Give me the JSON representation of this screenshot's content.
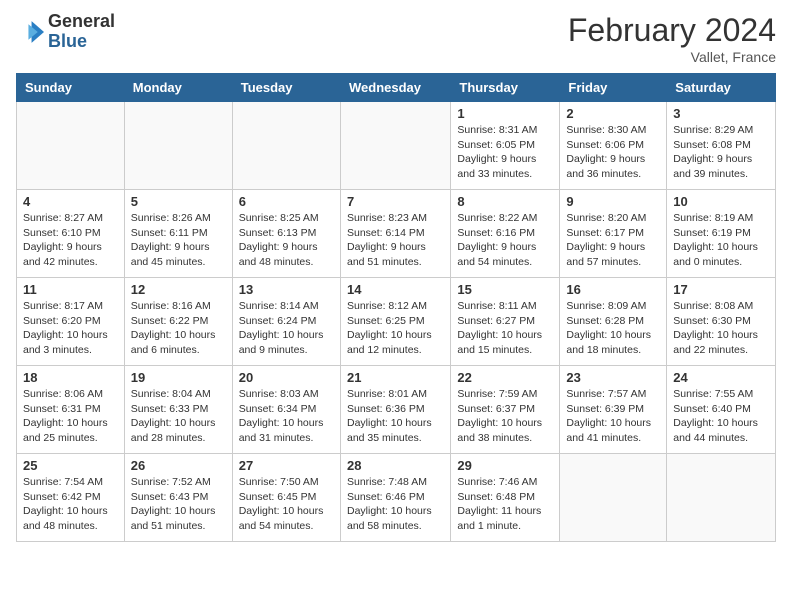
{
  "header": {
    "logo_general": "General",
    "logo_blue": "Blue",
    "title": "February 2024",
    "subtitle": "Vallet, France"
  },
  "days_of_week": [
    "Sunday",
    "Monday",
    "Tuesday",
    "Wednesday",
    "Thursday",
    "Friday",
    "Saturday"
  ],
  "weeks": [
    [
      {
        "day": "",
        "info": ""
      },
      {
        "day": "",
        "info": ""
      },
      {
        "day": "",
        "info": ""
      },
      {
        "day": "",
        "info": ""
      },
      {
        "day": "1",
        "info": "Sunrise: 8:31 AM\nSunset: 6:05 PM\nDaylight: 9 hours and 33 minutes."
      },
      {
        "day": "2",
        "info": "Sunrise: 8:30 AM\nSunset: 6:06 PM\nDaylight: 9 hours and 36 minutes."
      },
      {
        "day": "3",
        "info": "Sunrise: 8:29 AM\nSunset: 6:08 PM\nDaylight: 9 hours and 39 minutes."
      }
    ],
    [
      {
        "day": "4",
        "info": "Sunrise: 8:27 AM\nSunset: 6:10 PM\nDaylight: 9 hours and 42 minutes."
      },
      {
        "day": "5",
        "info": "Sunrise: 8:26 AM\nSunset: 6:11 PM\nDaylight: 9 hours and 45 minutes."
      },
      {
        "day": "6",
        "info": "Sunrise: 8:25 AM\nSunset: 6:13 PM\nDaylight: 9 hours and 48 minutes."
      },
      {
        "day": "7",
        "info": "Sunrise: 8:23 AM\nSunset: 6:14 PM\nDaylight: 9 hours and 51 minutes."
      },
      {
        "day": "8",
        "info": "Sunrise: 8:22 AM\nSunset: 6:16 PM\nDaylight: 9 hours and 54 minutes."
      },
      {
        "day": "9",
        "info": "Sunrise: 8:20 AM\nSunset: 6:17 PM\nDaylight: 9 hours and 57 minutes."
      },
      {
        "day": "10",
        "info": "Sunrise: 8:19 AM\nSunset: 6:19 PM\nDaylight: 10 hours and 0 minutes."
      }
    ],
    [
      {
        "day": "11",
        "info": "Sunrise: 8:17 AM\nSunset: 6:20 PM\nDaylight: 10 hours and 3 minutes."
      },
      {
        "day": "12",
        "info": "Sunrise: 8:16 AM\nSunset: 6:22 PM\nDaylight: 10 hours and 6 minutes."
      },
      {
        "day": "13",
        "info": "Sunrise: 8:14 AM\nSunset: 6:24 PM\nDaylight: 10 hours and 9 minutes."
      },
      {
        "day": "14",
        "info": "Sunrise: 8:12 AM\nSunset: 6:25 PM\nDaylight: 10 hours and 12 minutes."
      },
      {
        "day": "15",
        "info": "Sunrise: 8:11 AM\nSunset: 6:27 PM\nDaylight: 10 hours and 15 minutes."
      },
      {
        "day": "16",
        "info": "Sunrise: 8:09 AM\nSunset: 6:28 PM\nDaylight: 10 hours and 18 minutes."
      },
      {
        "day": "17",
        "info": "Sunrise: 8:08 AM\nSunset: 6:30 PM\nDaylight: 10 hours and 22 minutes."
      }
    ],
    [
      {
        "day": "18",
        "info": "Sunrise: 8:06 AM\nSunset: 6:31 PM\nDaylight: 10 hours and 25 minutes."
      },
      {
        "day": "19",
        "info": "Sunrise: 8:04 AM\nSunset: 6:33 PM\nDaylight: 10 hours and 28 minutes."
      },
      {
        "day": "20",
        "info": "Sunrise: 8:03 AM\nSunset: 6:34 PM\nDaylight: 10 hours and 31 minutes."
      },
      {
        "day": "21",
        "info": "Sunrise: 8:01 AM\nSunset: 6:36 PM\nDaylight: 10 hours and 35 minutes."
      },
      {
        "day": "22",
        "info": "Sunrise: 7:59 AM\nSunset: 6:37 PM\nDaylight: 10 hours and 38 minutes."
      },
      {
        "day": "23",
        "info": "Sunrise: 7:57 AM\nSunset: 6:39 PM\nDaylight: 10 hours and 41 minutes."
      },
      {
        "day": "24",
        "info": "Sunrise: 7:55 AM\nSunset: 6:40 PM\nDaylight: 10 hours and 44 minutes."
      }
    ],
    [
      {
        "day": "25",
        "info": "Sunrise: 7:54 AM\nSunset: 6:42 PM\nDaylight: 10 hours and 48 minutes."
      },
      {
        "day": "26",
        "info": "Sunrise: 7:52 AM\nSunset: 6:43 PM\nDaylight: 10 hours and 51 minutes."
      },
      {
        "day": "27",
        "info": "Sunrise: 7:50 AM\nSunset: 6:45 PM\nDaylight: 10 hours and 54 minutes."
      },
      {
        "day": "28",
        "info": "Sunrise: 7:48 AM\nSunset: 6:46 PM\nDaylight: 10 hours and 58 minutes."
      },
      {
        "day": "29",
        "info": "Sunrise: 7:46 AM\nSunset: 6:48 PM\nDaylight: 11 hours and 1 minute."
      },
      {
        "day": "",
        "info": ""
      },
      {
        "day": "",
        "info": ""
      }
    ]
  ]
}
